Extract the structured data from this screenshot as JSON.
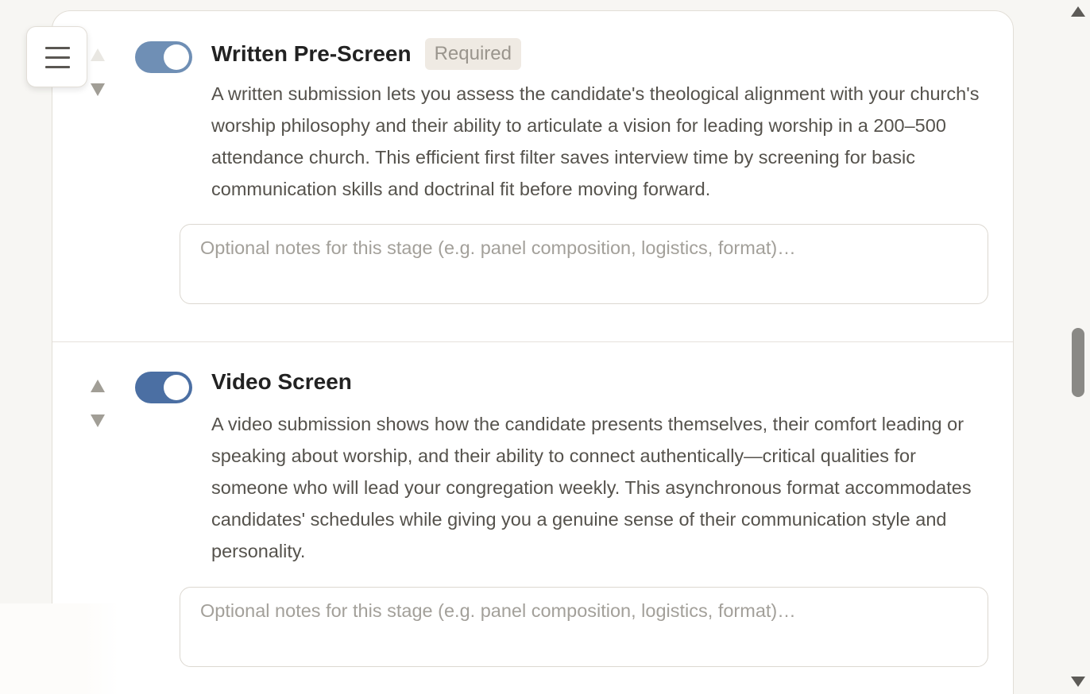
{
  "menu": {
    "icon": "hamburger-menu-icon"
  },
  "stages": [
    {
      "title": "Written Pre-Screen",
      "badge": "Required",
      "enabled": true,
      "toggle_color": "#6f8fb5",
      "move_up_enabled": false,
      "description": "A written submission lets you assess the candidate's theological alignment with your church's worship philosophy and their ability to articulate a vision for leading worship in a 200–500 attendance church. This efficient first filter saves interview time by screening for basic communication skills and doctrinal fit before moving forward.",
      "notes_placeholder": "Optional notes for this stage (e.g. panel composition, logistics, format)…",
      "notes_value": ""
    },
    {
      "title": "Video Screen",
      "enabled": true,
      "toggle_color": "#4b6fa3",
      "move_up_enabled": true,
      "description": "A video submission shows how the candidate presents themselves, their comfort leading or speaking about worship, and their ability to connect authentically—critical qualities for someone who will lead your congregation weekly. This asynchronous format accommodates candidates' schedules while giving you a genuine sense of their communication style and personality.",
      "notes_placeholder": "Optional notes for this stage (e.g. panel composition, logistics, format)…",
      "notes_value": ""
    }
  ],
  "colors": {
    "page_background": "#f7f6f3",
    "card_background": "#ffffff",
    "text_primary": "#222222",
    "text_body": "#55524c",
    "badge_background": "#efeae3",
    "arrow": "#a19e96"
  }
}
